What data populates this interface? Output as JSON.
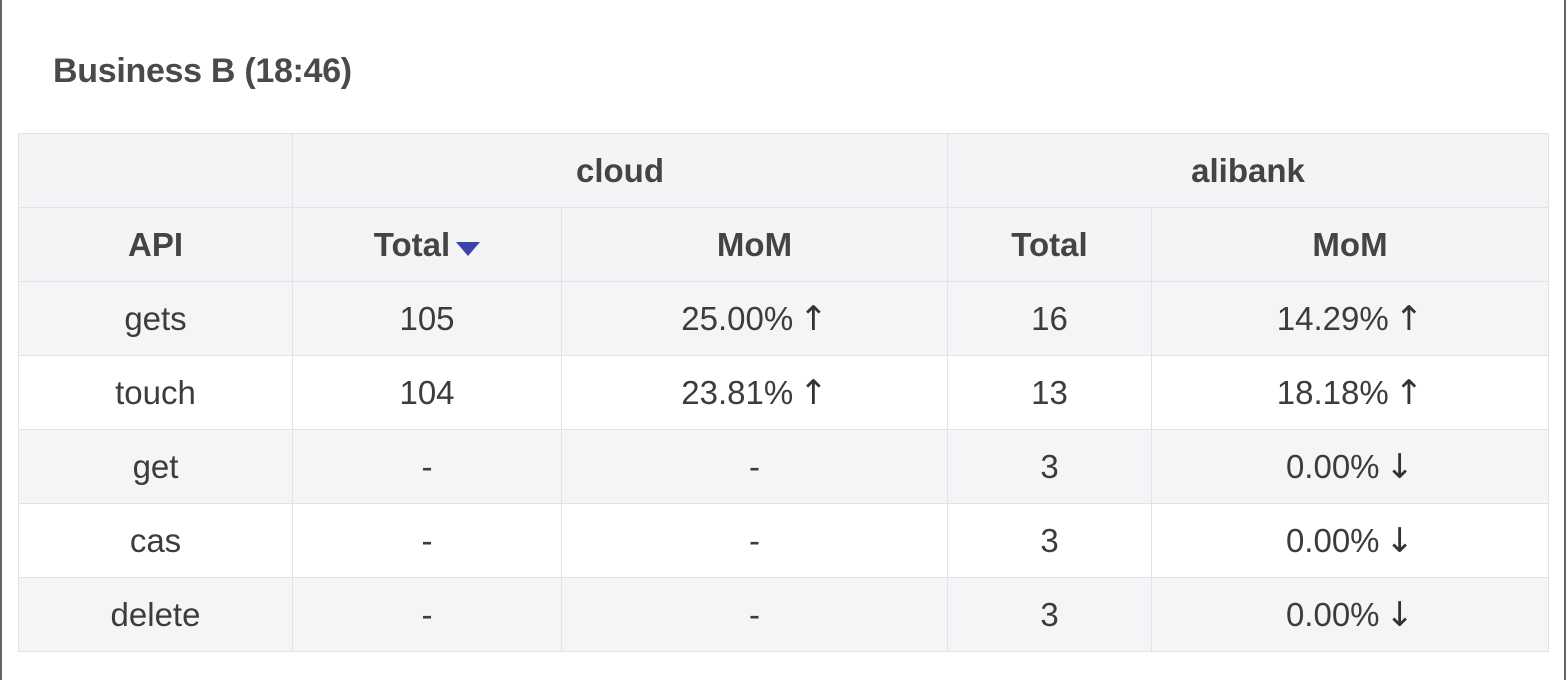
{
  "title": "Business B (18:46)",
  "table": {
    "groups": [
      "cloud",
      "alibank"
    ],
    "headers": {
      "api": "API",
      "cloud_total": "Total",
      "cloud_mom": "MoM",
      "alibank_total": "Total",
      "alibank_mom": "MoM"
    },
    "sort": {
      "column": "cloud_total",
      "direction": "desc",
      "color": "#3b44a8"
    },
    "rows": [
      {
        "api": "gets",
        "cloud_total": "105",
        "cloud_mom": "25.00%",
        "cloud_arrow": "↑",
        "alibank_total": "16",
        "alibank_mom": "14.29%",
        "alibank_arrow": "↑"
      },
      {
        "api": "touch",
        "cloud_total": "104",
        "cloud_mom": "23.81%",
        "cloud_arrow": "↑",
        "alibank_total": "13",
        "alibank_mom": "18.18%",
        "alibank_arrow": "↑"
      },
      {
        "api": "get",
        "cloud_total": "-",
        "cloud_mom": "-",
        "cloud_arrow": "",
        "alibank_total": "3",
        "alibank_mom": "0.00%",
        "alibank_arrow": "↓"
      },
      {
        "api": "cas",
        "cloud_total": "-",
        "cloud_mom": "-",
        "cloud_arrow": "",
        "alibank_total": "3",
        "alibank_mom": "0.00%",
        "alibank_arrow": "↓"
      },
      {
        "api": "delete",
        "cloud_total": "-",
        "cloud_mom": "-",
        "cloud_arrow": "",
        "alibank_total": "3",
        "alibank_mom": "0.00%",
        "alibank_arrow": "↓"
      }
    ]
  }
}
